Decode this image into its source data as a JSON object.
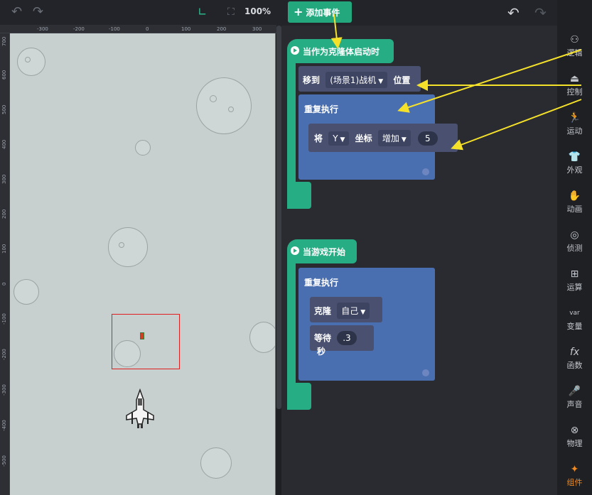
{
  "toolbar": {
    "zoom": "100%",
    "add_event": "添加事件"
  },
  "ruler": {
    "top": [
      "-300",
      "-200",
      "-100",
      "0",
      "100",
      "200",
      "300"
    ],
    "left": [
      "700",
      "600",
      "500",
      "400",
      "300",
      "200",
      "100",
      "0",
      "-100",
      "-200",
      "-300",
      "-400",
      "-500"
    ]
  },
  "blocks": {
    "event1": {
      "hat": "当作为克隆体启动时",
      "move_to": "移到",
      "target": "(场景1)战机",
      "position": "位置",
      "repeat": "重复执行",
      "set_label": "将",
      "axis": "Y",
      "coord": "坐标",
      "op": "增加",
      "amount": "5"
    },
    "event2": {
      "hat": "当游戏开始",
      "repeat": "重复执行",
      "clone": "克隆",
      "clone_target": "自己",
      "wait": "等待",
      "wait_val": ".3",
      "seconds": "秒"
    }
  },
  "sidebar": {
    "items": [
      {
        "label": "逻辑",
        "icon": "logic-icon"
      },
      {
        "label": "控制",
        "icon": "control-icon"
      },
      {
        "label": "运动",
        "icon": "motion-icon"
      },
      {
        "label": "外观",
        "icon": "looks-icon"
      },
      {
        "label": "动画",
        "icon": "animation-icon"
      },
      {
        "label": "侦测",
        "icon": "sensing-icon"
      },
      {
        "label": "运算",
        "icon": "operators-icon"
      },
      {
        "label": "变量",
        "icon": "variables-icon"
      },
      {
        "label": "函数",
        "icon": "functions-icon"
      },
      {
        "label": "声音",
        "icon": "sound-icon"
      },
      {
        "label": "物理",
        "icon": "physics-icon"
      },
      {
        "label": "组件",
        "icon": "components-icon"
      }
    ]
  },
  "colors": {
    "event": "#27ad83",
    "control": "#4a6fb0",
    "active": "#ef8a22"
  }
}
